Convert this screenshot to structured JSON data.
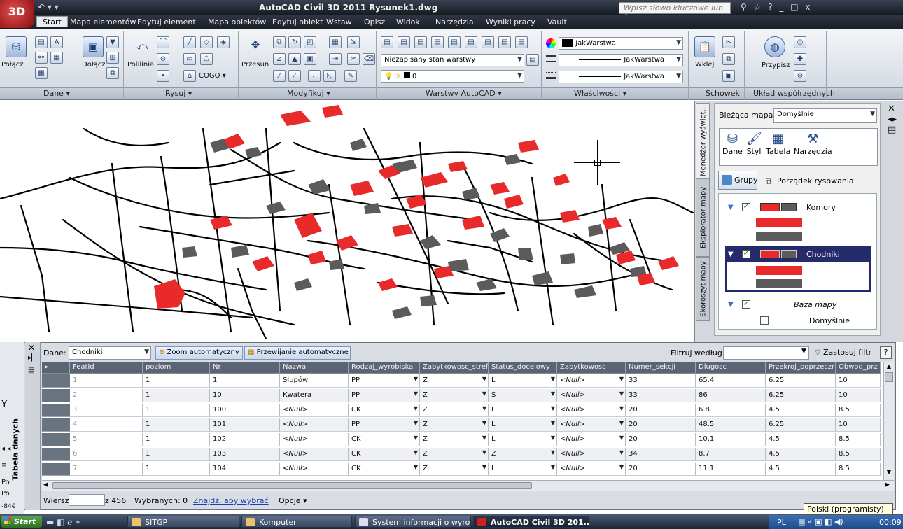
{
  "title_bar": {
    "app_button_label": "3D",
    "title": "AutoCAD Civil 3D 2011   Rysunek1.dwg",
    "search_placeholder": "Wpisz słowo kluczowe lub frazę",
    "window_controls": "_ □ x"
  },
  "menu": {
    "items": [
      "Start",
      "Mapa elementów",
      "Edytuj element",
      "Mapa obiektów",
      "Edytuj obiekt",
      "Wstaw",
      "Opisz",
      "Widok",
      "Narzędzia",
      "Wyniki pracy",
      "Vault"
    ],
    "active": "Start"
  },
  "ribbon": {
    "panels": {
      "dane": {
        "title": "Dane ▾",
        "labels": [
          "Połącz",
          "Dołącz"
        ]
      },
      "rysuj": {
        "title": "Rysuj ▾",
        "labels": [
          "Polilinia",
          "COGO ▾"
        ]
      },
      "modyfikuj": {
        "title": "Modyfikuj ▾",
        "labels": [
          "Przesuń"
        ]
      },
      "warstwy": {
        "title": "Warstwy AutoCAD ▾",
        "layer_state": "Niezapisany stan warstwy",
        "current_layer": "0"
      },
      "wlasciwosci": {
        "title": "Właściwości ▾",
        "color": "JakWarstwa",
        "linetype": "JakWarstwa",
        "lineweight": "JakWarstwa"
      },
      "schowek": {
        "title": "Schowek",
        "labels": [
          "Wklej"
        ]
      },
      "uklad": {
        "title": "Układ współrzędnych",
        "labels": [
          "Przypisz"
        ]
      }
    }
  },
  "task_pane": {
    "tabs": [
      "Menedżer wyświet...",
      "Eksplorator mapy",
      "Skoroszyt mapy"
    ],
    "current_map_label": "Bieżąca mapa:",
    "current_map_value": "Domyślnie",
    "tools": [
      "Dane",
      "Styl",
      "Tabela",
      "Narzędzia"
    ],
    "groups_button": "Grupy",
    "draw_order_label": "Porządek rysowania",
    "layers": [
      {
        "name": "Komory",
        "checked": true
      },
      {
        "name": "Chodniki",
        "checked": true,
        "selected": true
      },
      {
        "name": "Baza mapy",
        "checked": true
      },
      {
        "name": "Domyślnie",
        "checked": false
      }
    ],
    "layer_colors": {
      "red": "#e82a2a",
      "gray": "#5b5b5b"
    }
  },
  "data_table": {
    "side_label": "Tabela danych",
    "dane_label": "Dane:",
    "dane_value": "Chodniki",
    "zoom_auto": "Zoom automatyczny",
    "pan_auto": "Przewijanie automatyczne",
    "filter_label": "Filtruj według:",
    "apply_filter": "Zastosuj filtr",
    "help": "?",
    "columns": [
      "FeatId",
      "poziom",
      "Nr",
      "Nazwa",
      "Rodzaj_wyrobiska",
      "Zabytkowosc_stref",
      "Status_docelowy",
      "Zabytkowosc",
      "Numer_sekcji",
      "Dlugosc",
      "Przekroj_poprzeczr",
      "Obwod_prz"
    ],
    "rows": [
      [
        "1",
        "1",
        "1",
        "Słupów",
        "PP",
        "Z",
        "L",
        "<Null>",
        "33",
        "65.4",
        "6.25",
        "10"
      ],
      [
        "2",
        "1",
        "10",
        "Kwatera",
        "PP",
        "Z",
        "S",
        "<Null>",
        "33",
        "86",
        "6.25",
        "10"
      ],
      [
        "3",
        "1",
        "100",
        "<Null>",
        "CK",
        "Z",
        "L",
        "<Null>",
        "20",
        "6.8",
        "4.5",
        "8.5"
      ],
      [
        "4",
        "1",
        "101",
        "<Null>",
        "PP",
        "Z",
        "L",
        "<Null>",
        "20",
        "48.5",
        "6.25",
        "10"
      ],
      [
        "5",
        "1",
        "102",
        "<Null>",
        "CK",
        "Z",
        "L",
        "<Null>",
        "20",
        "10.1",
        "4.5",
        "8.5"
      ],
      [
        "6",
        "1",
        "103",
        "<Null>",
        "CK",
        "Z",
        "Z",
        "<Null>",
        "34",
        "8.7",
        "4.5",
        "8.5"
      ],
      [
        "7",
        "1",
        "104",
        "<Null>",
        "CK",
        "Z",
        "L",
        "<Null>",
        "20",
        "11.1",
        "4.5",
        "8.5"
      ]
    ],
    "status": {
      "row_label": "Wiersz",
      "of_total": "z 456",
      "selected": "Wybranych: 0",
      "find_link": "Znajdź, aby wybrać",
      "options": "Opcje ▾"
    }
  },
  "taskbar": {
    "start": "Start",
    "tasks": [
      "SITGP",
      "Komputer",
      "System informacji o wyro...",
      "AutoCAD Civil 3D 201..."
    ],
    "language": "PL",
    "clock": "00:09",
    "tooltip": "Polski (programisty)"
  }
}
